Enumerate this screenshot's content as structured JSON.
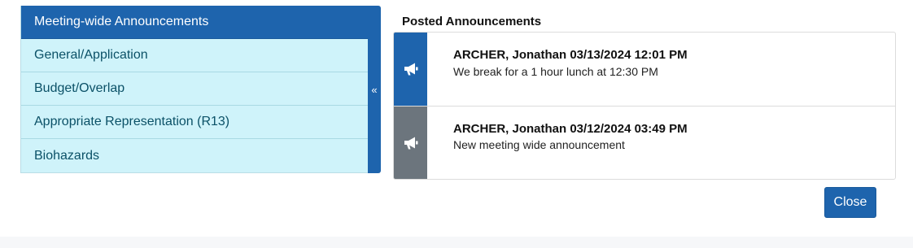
{
  "nav": {
    "items": [
      {
        "label": "Meeting-wide Announcements",
        "active": true
      },
      {
        "label": "General/Application",
        "active": false
      },
      {
        "label": "Budget/Overlap",
        "active": false
      },
      {
        "label": "Appropriate Representation (R13)",
        "active": false
      },
      {
        "label": "Biohazards",
        "active": false
      }
    ],
    "collapse_glyph": "«"
  },
  "posted": {
    "title": "Posted Announcements",
    "announcements": [
      {
        "header": "ARCHER, Jonathan 03/13/2024 12:01 PM",
        "body": "We break for a 1 hour lunch at 12:30 PM",
        "icon": "megaphone-icon",
        "accent": "#1e64ad"
      },
      {
        "header": "ARCHER, Jonathan 03/12/2024 03:49 PM",
        "body": "New meeting wide announcement",
        "icon": "megaphone-icon",
        "accent": "#6c757d"
      }
    ]
  },
  "footer": {
    "close_label": "Close"
  },
  "colors": {
    "primary": "#1e64ad",
    "nav_item_bg": "#cff3fa",
    "nav_item_text": "#0b5167",
    "secondary": "#6c757d"
  }
}
